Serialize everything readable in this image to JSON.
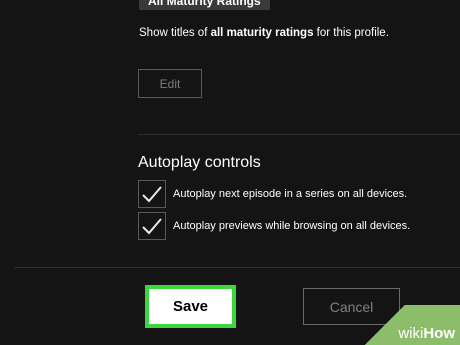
{
  "maturity": {
    "badge_label": "All Maturity Ratings",
    "desc_prefix": "Show titles of ",
    "desc_bold": "all maturity ratings",
    "desc_suffix": " for this profile.",
    "edit_label": "Edit"
  },
  "autoplay": {
    "title": "Autoplay controls",
    "options": [
      {
        "label": "Autoplay next episode in a series on all devices.",
        "checked": true
      },
      {
        "label": "Autoplay previews while browsing on all devices.",
        "checked": true
      }
    ]
  },
  "actions": {
    "save_label": "Save",
    "cancel_label": "Cancel"
  },
  "watermark": {
    "part1": "wiki",
    "part2": "How"
  },
  "colors": {
    "background": "#141414",
    "save_highlight": "#3bd63b",
    "watermark_green": "#8cbd6a"
  }
}
